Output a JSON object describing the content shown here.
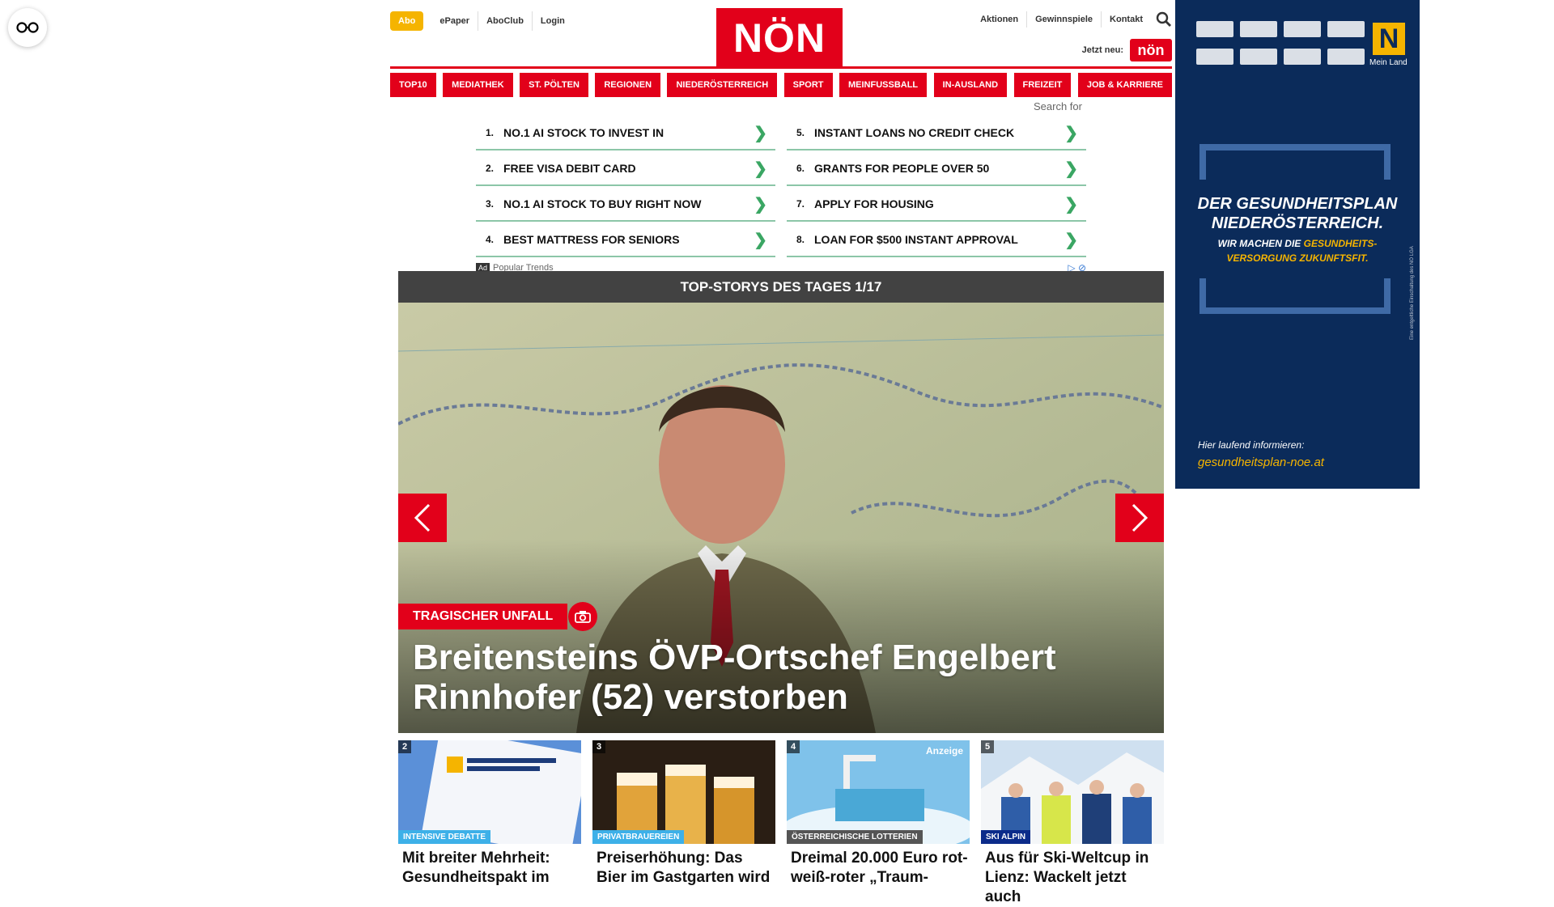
{
  "header": {
    "abo": "Abo",
    "top_links": [
      "ePaper",
      "AboClub",
      "Login"
    ],
    "logo": "NÖN",
    "right_links": [
      "Aktionen",
      "Gewinnspiele",
      "Kontakt"
    ],
    "jetzt_neu": "Jetzt neu:",
    "jetzt_logo": "nön"
  },
  "categories": [
    "TOP10",
    "MEDIATHEK",
    "ST. PÖLTEN",
    "REGIONEN",
    "NIEDERÖSTERREICH",
    "SPORT",
    "MEINFUSSBALL",
    "IN-AUSLAND",
    "FREIZEIT",
    "JOB & KARRIERE"
  ],
  "ad_search": {
    "label": "Search for",
    "left": [
      {
        "num": "1.",
        "text": "NO.1 AI STOCK TO INVEST IN"
      },
      {
        "num": "2.",
        "text": "FREE VISA DEBIT CARD"
      },
      {
        "num": "3.",
        "text": "NO.1 AI STOCK TO BUY RIGHT NOW"
      },
      {
        "num": "4.",
        "text": "BEST MATTRESS FOR SENIORS"
      }
    ],
    "right": [
      {
        "num": "5.",
        "text": "INSTANT LOANS NO CREDIT CHECK"
      },
      {
        "num": "6.",
        "text": "GRANTS FOR PEOPLE OVER 50"
      },
      {
        "num": "7.",
        "text": "APPLY FOR HOUSING"
      },
      {
        "num": "8.",
        "text": "LOAN FOR $500 INSTANT APPROVAL"
      }
    ],
    "badge": "Ad",
    "footer": "Popular Trends"
  },
  "top_stories": {
    "header": "TOP-STORYS DES TAGES 1/17",
    "kicker": "TRAGISCHER UNFALL",
    "title": "Breitensteins ÖVP-Ortschef Engelbert Rinnhofer (52) verstorben"
  },
  "teasers": [
    {
      "num": "2",
      "tag": "INTENSIVE DEBATTE",
      "title": "Mit breiter Mehrheit: Gesundheitspakt im",
      "tag_color": "#3db0e8",
      "anzeige": ""
    },
    {
      "num": "3",
      "tag": "PRIVATBRAUEREIEN",
      "title": "Preiserhöhung: Das Bier im Gastgarten wird",
      "tag_color": "#3db0e8",
      "anzeige": ""
    },
    {
      "num": "4",
      "tag": "ÖSTERREICHISCHE LOTTERIEN",
      "title": "Dreimal 20.000 Euro rot-weiß-roter „Traum-",
      "tag_color": "#555555",
      "anzeige": "Anzeige"
    },
    {
      "num": "5",
      "tag": "SKI ALPIN",
      "title": "Aus für Ski-Weltcup in Lienz: Wackelt jetzt auch",
      "tag_color": "#0b2b8a",
      "anzeige": ""
    }
  ],
  "side_ad": {
    "headline_1": "DER GESUNDHEITSPLAN",
    "headline_2": "NIEDERÖSTERREICH.",
    "sub_1": "WIR MACHEN DIE",
    "sub_2": "GESUNDHEITS-",
    "sub_3": "VERSORGUNG ZUKUNFTSFIT.",
    "footer_1": "Hier laufend informieren:",
    "footer_2": "gesundheitsplan-noe.at",
    "brand": "Mein Land",
    "n_logo": "N",
    "vertical_note": "Eine entgeltliche Einschaltung des NÖ LGA"
  },
  "colors": {
    "brand_red": "#e2001a",
    "abo_yellow": "#f5b400",
    "ad_blue": "#0b2b5a"
  }
}
